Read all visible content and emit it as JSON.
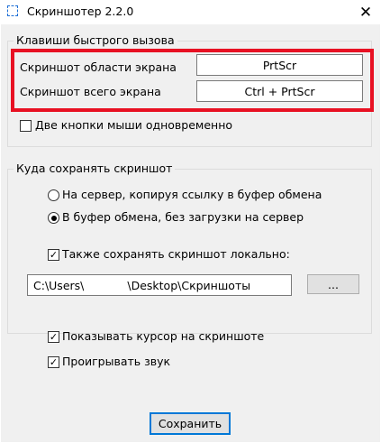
{
  "window": {
    "title": "Скриншотер 2.2.0",
    "close_glyph": "✕"
  },
  "hotkeys": {
    "legend": "Клавиши быстрого вызова",
    "area_label": "Скриншот области экрана",
    "area_value": "PrtScr",
    "full_label": "Скриншот всего экрана",
    "full_value": "Ctrl + PrtScr",
    "both_mouse_label": "Две кнопки мыши одновременно",
    "both_mouse_checked": false
  },
  "save": {
    "legend": "Куда сохранять скриншот",
    "option_server": "На сервер, копируя ссылку в буфер обмена",
    "option_clipboard": "В буфер обмена, без загрузки на сервер",
    "selected": "clipboard",
    "save_local_label": "Также сохранять скриншот локально:",
    "save_local_checked": true,
    "path_prefix": "C:\\Users\\",
    "path_suffix": "\\Desktop\\Скриншоты",
    "browse_label": "..."
  },
  "options": {
    "show_cursor_label": "Показывать курсор на скриншоте",
    "show_cursor_checked": true,
    "play_sound_label": "Проигрывать звук",
    "play_sound_checked": true
  },
  "footer": {
    "save_button": "Сохранить"
  },
  "glyphs": {
    "check": "✓"
  },
  "colors": {
    "highlight": "#e81123",
    "default_button_border": "#0078d7"
  }
}
